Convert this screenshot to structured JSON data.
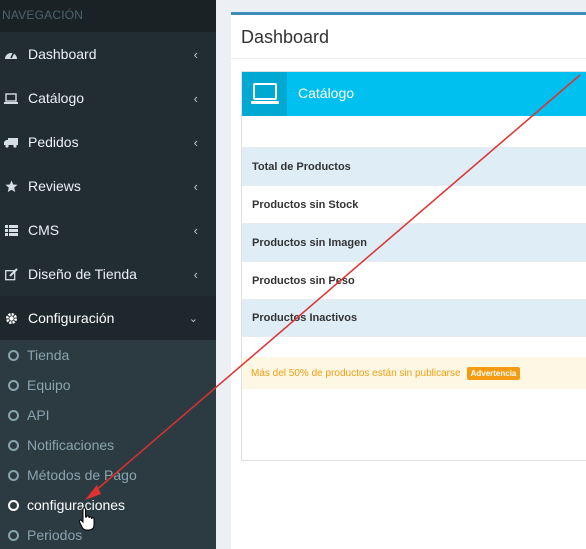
{
  "sidebar": {
    "header": "NAVEGACIÓN",
    "items": [
      {
        "label": "Dashboard",
        "icon": "dashboard-icon"
      },
      {
        "label": "Catálogo",
        "icon": "laptop-icon"
      },
      {
        "label": "Pedidos",
        "icon": "truck-icon"
      },
      {
        "label": "Reviews",
        "icon": "star-icon"
      },
      {
        "label": "CMS",
        "icon": "list-icon"
      },
      {
        "label": "Diseño de Tienda",
        "icon": "edit-icon"
      },
      {
        "label": "Configuración",
        "icon": "gear-icon"
      }
    ],
    "submenu": [
      {
        "label": "Tienda"
      },
      {
        "label": "Equipo"
      },
      {
        "label": "API"
      },
      {
        "label": "Notificaciones"
      },
      {
        "label": "Métodos de Pago"
      },
      {
        "label": "configuraciones"
      },
      {
        "label": "Periodos"
      }
    ]
  },
  "main": {
    "title": "Dashboard",
    "widget": {
      "title": "Catálogo",
      "rows": [
        {
          "label": "Total de Productos"
        },
        {
          "label": "Productos sin Stock"
        },
        {
          "label": "Productos sin Imagen"
        },
        {
          "label": "Productos sin Peso"
        },
        {
          "label": "Productos Inactivos"
        }
      ],
      "warning": {
        "text": "Más del 50% de productos están sin publicarse",
        "badge": "Advertencia"
      }
    }
  },
  "colors": {
    "sidebar_bg": "#222d32",
    "accent": "#00c0ef",
    "warning": "#f39c12",
    "arrow": "#e03030"
  }
}
